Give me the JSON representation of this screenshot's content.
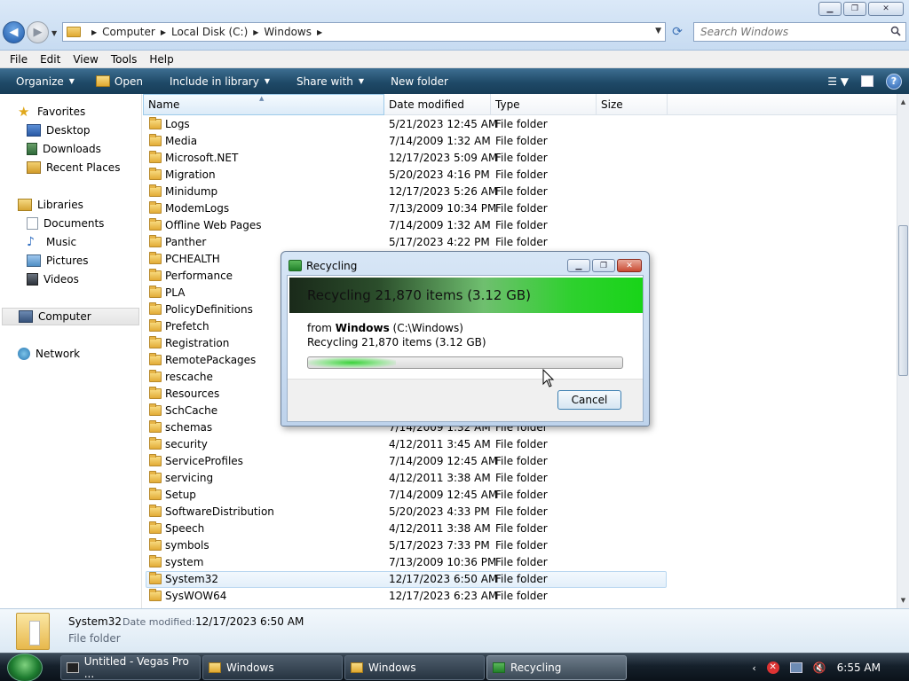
{
  "address": {
    "crumbs": [
      "Computer",
      "Local Disk (C:)",
      "Windows"
    ],
    "search_placeholder": "Search Windows"
  },
  "menu": [
    "File",
    "Edit",
    "View",
    "Tools",
    "Help"
  ],
  "toolbar": {
    "organize": "Organize",
    "open": "Open",
    "include": "Include in library",
    "share": "Share with",
    "new_folder": "New folder"
  },
  "nav": {
    "favorites": "Favorites",
    "desktop": "Desktop",
    "downloads": "Downloads",
    "recent": "Recent Places",
    "libraries": "Libraries",
    "documents": "Documents",
    "music": "Music",
    "pictures": "Pictures",
    "videos": "Videos",
    "computer": "Computer",
    "network": "Network"
  },
  "columns": {
    "name": "Name",
    "date": "Date modified",
    "type": "Type",
    "size": "Size"
  },
  "files": [
    {
      "name": "Logs",
      "date": "5/21/2023 12:45 AM",
      "type": "File folder"
    },
    {
      "name": "Media",
      "date": "7/14/2009 1:32 AM",
      "type": "File folder"
    },
    {
      "name": "Microsoft.NET",
      "date": "12/17/2023 5:09 AM",
      "type": "File folder"
    },
    {
      "name": "Migration",
      "date": "5/20/2023 4:16 PM",
      "type": "File folder"
    },
    {
      "name": "Minidump",
      "date": "12/17/2023 5:26 AM",
      "type": "File folder"
    },
    {
      "name": "ModemLogs",
      "date": "7/13/2009 10:34 PM",
      "type": "File folder"
    },
    {
      "name": "Offline Web Pages",
      "date": "7/14/2009 1:32 AM",
      "type": "File folder"
    },
    {
      "name": "Panther",
      "date": "5/17/2023 4:22 PM",
      "type": "File folder"
    },
    {
      "name": "PCHEALTH",
      "date": "",
      "type": ""
    },
    {
      "name": "Performance",
      "date": "",
      "type": ""
    },
    {
      "name": "PLA",
      "date": "",
      "type": ""
    },
    {
      "name": "PolicyDefinitions",
      "date": "",
      "type": ""
    },
    {
      "name": "Prefetch",
      "date": "",
      "type": ""
    },
    {
      "name": "Registration",
      "date": "",
      "type": ""
    },
    {
      "name": "RemotePackages",
      "date": "",
      "type": ""
    },
    {
      "name": "rescache",
      "date": "",
      "type": ""
    },
    {
      "name": "Resources",
      "date": "",
      "type": ""
    },
    {
      "name": "SchCache",
      "date": "",
      "type": ""
    },
    {
      "name": "schemas",
      "date": "7/14/2009 1:32 AM",
      "type": "File folder"
    },
    {
      "name": "security",
      "date": "4/12/2011 3:45 AM",
      "type": "File folder"
    },
    {
      "name": "ServiceProfiles",
      "date": "7/14/2009 12:45 AM",
      "type": "File folder"
    },
    {
      "name": "servicing",
      "date": "4/12/2011 3:38 AM",
      "type": "File folder"
    },
    {
      "name": "Setup",
      "date": "7/14/2009 12:45 AM",
      "type": "File folder"
    },
    {
      "name": "SoftwareDistribution",
      "date": "5/20/2023 4:33 PM",
      "type": "File folder"
    },
    {
      "name": "Speech",
      "date": "4/12/2011 3:38 AM",
      "type": "File folder"
    },
    {
      "name": "symbols",
      "date": "5/17/2023 7:33 PM",
      "type": "File folder"
    },
    {
      "name": "system",
      "date": "7/13/2009 10:36 PM",
      "type": "File folder"
    },
    {
      "name": "System32",
      "date": "12/17/2023 6:50 AM",
      "type": "File folder",
      "selected": true
    },
    {
      "name": "SysWOW64",
      "date": "12/17/2023 6:23 AM",
      "type": "File folder"
    }
  ],
  "details": {
    "name": "System32",
    "date_label": "Date modified:",
    "date": "12/17/2023 6:50 AM",
    "type": "File folder"
  },
  "dialog": {
    "title": "Recycling",
    "banner": "Recycling 21,870 items (3.12 GB)",
    "from_prefix": "from ",
    "from_name": "Windows",
    "from_path": " (C:\\Windows)",
    "sub": "Recycling 21,870 items (3.12 GB)",
    "progress": 0.28,
    "cancel": "Cancel"
  },
  "taskbar": {
    "items": [
      "Untitled - Vegas Pro ...",
      "Windows",
      "Windows",
      "Recycling"
    ],
    "clock": "6:55 AM"
  },
  "colors": {
    "accent": "#1d57a8",
    "banner_green": "#18d418"
  }
}
